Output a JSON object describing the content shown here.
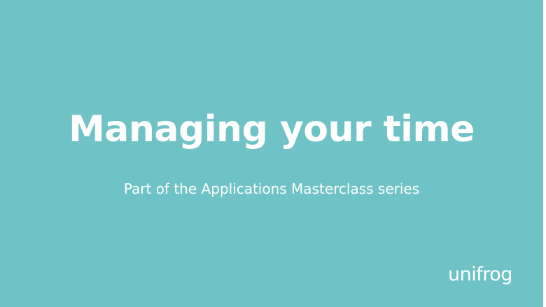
{
  "slide": {
    "title": "Managing your time",
    "subtitle": "Part of the Applications Masterclass series",
    "logo_text": "unifrog"
  },
  "colors": {
    "background": "#6fc3c6",
    "text": "#ffffff"
  }
}
